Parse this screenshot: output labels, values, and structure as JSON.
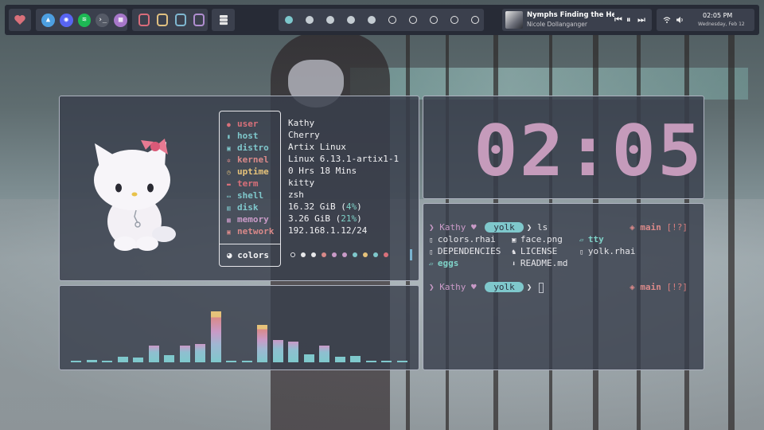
{
  "colors": {
    "accent_pink": "#c59bbb",
    "accent_teal": "#7fc8cc",
    "panel_bg": "#383e4c",
    "bar_bg": "#272b36"
  },
  "topbar": {
    "launcher_icon": "heart-icon",
    "apps": [
      {
        "name": "arch-icon",
        "color": "#4d9fe0"
      },
      {
        "name": "discord-icon",
        "color": "#5865f2"
      },
      {
        "name": "spotify-icon",
        "color": "#1db954"
      },
      {
        "name": "terminal-icon",
        "color": "#555a66"
      },
      {
        "name": "system-monitor-icon",
        "color": "#a777c9"
      }
    ],
    "utils": [
      {
        "name": "mic-icon",
        "color": "#d96c7a"
      },
      {
        "name": "clipboard-icon",
        "color": "#e0c080"
      },
      {
        "name": "screenshot-icon",
        "color": "#7fb7d0"
      },
      {
        "name": "picker-icon",
        "color": "#b08ed0"
      }
    ],
    "workspaces": [
      "active",
      "filled",
      "filled",
      "filled",
      "filled",
      "empty",
      "empty",
      "empty",
      "empty",
      "empty"
    ],
    "music": {
      "title": "Nymphs Finding the He...",
      "artist": "Nicole Dollanganger",
      "prev": "⏮",
      "pause": "⏸",
      "next": "⏭"
    },
    "system": {
      "wifi_icon": "wifi-icon",
      "volume_icon": "volume-icon",
      "time": "02:05 PM",
      "date": "Wednesday, Feb 12"
    }
  },
  "fetch": {
    "rows": [
      {
        "key": "user",
        "value": "Kathy",
        "color": "#d9707a",
        "icon": "user-icon"
      },
      {
        "key": "host",
        "value": "Cherry",
        "color": "#7fc8cc",
        "icon": "host-icon"
      },
      {
        "key": "distro",
        "value": "Artix Linux",
        "color": "#7fc8cc",
        "icon": "distro-icon"
      },
      {
        "key": "kernel",
        "value": "Linux 6.13.1-artix1-1",
        "color": "#d98989",
        "icon": "kernel-icon"
      },
      {
        "key": "uptime",
        "value": "0 Hrs 18 Mins",
        "color": "#e6c27a",
        "icon": "uptime-icon"
      },
      {
        "key": "term",
        "value": "kitty",
        "color": "#d9707a",
        "icon": "term-icon"
      },
      {
        "key": "shell",
        "value": "zsh",
        "color": "#7fc8cc",
        "icon": "shell-icon"
      },
      {
        "key": "disk",
        "value_main": "16.32 GiB (",
        "value_pct": "4%",
        "value_end": ")",
        "color": "#7fc8cc",
        "icon": "disk-icon"
      },
      {
        "key": "memory",
        "value_main": "3.26 GiB (",
        "value_pct": "21%",
        "value_end": ")",
        "color": "#c99ac7",
        "icon": "memory-icon"
      },
      {
        "key": "network",
        "value": "192.168.1.12/24",
        "color": "#d98989",
        "icon": "network-icon"
      }
    ],
    "colors_label": "colors",
    "palette": [
      "#2c3240",
      "#e8e8ea",
      "#e8e8ea",
      "#d98989",
      "#c99ac7",
      "#c99ac7",
      "#7fc8cc",
      "#e6c27a",
      "#7fc8cc",
      "#d9707a"
    ]
  },
  "clock": {
    "digits": "02:05"
  },
  "visualizer": {
    "levels": [
      0.02,
      0.03,
      0.02,
      0.06,
      0.05,
      0.18,
      0.08,
      0.18,
      0.2,
      0.55,
      0.02,
      0.02,
      0.4,
      0.24,
      0.22,
      0.09,
      0.18,
      0.06,
      0.07,
      0.02,
      0.02,
      0.02
    ]
  },
  "terminal": {
    "prompt1": {
      "user": "Kathy",
      "heart": "♥",
      "dir": "yolk",
      "arrow": "❯",
      "cmd": "ls",
      "branch": "main",
      "status": "[!?]"
    },
    "ls": [
      {
        "icon": "file-icon",
        "name": "colors.rhai",
        "dir": false
      },
      {
        "icon": "image-icon",
        "name": "face.png",
        "dir": false
      },
      {
        "icon": "folder-icon",
        "name": "tty",
        "dir": true
      },
      {
        "icon": "file-icon",
        "name": "DEPENDENCIES",
        "dir": false
      },
      {
        "icon": "license-icon",
        "name": "LICENSE",
        "dir": false
      },
      {
        "icon": "file-icon",
        "name": "yolk.rhai",
        "dir": false
      },
      {
        "icon": "folder-icon",
        "name": "eggs",
        "dir": true
      },
      {
        "icon": "readme-icon",
        "name": "README.md",
        "dir": false
      }
    ],
    "prompt2": {
      "user": "Kathy",
      "heart": "♥",
      "dir": "yolk",
      "arrow": "❯",
      "branch": "main",
      "status": "[!?]"
    }
  }
}
